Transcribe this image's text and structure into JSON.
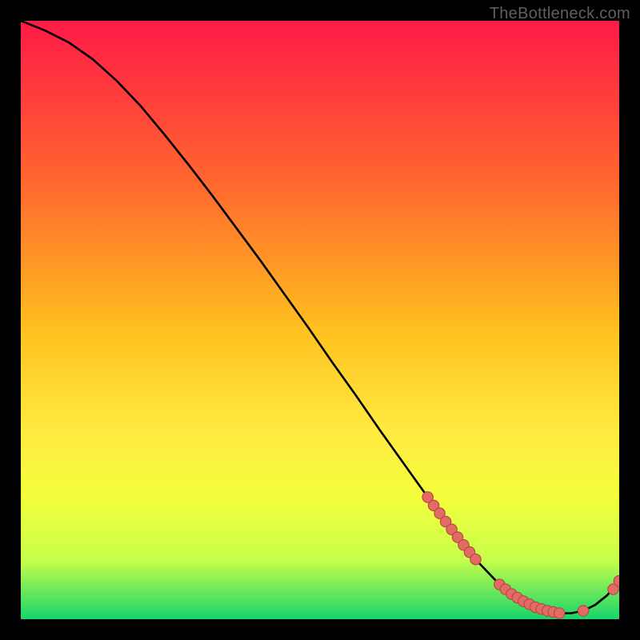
{
  "watermark": "TheBottleneck.com",
  "colors": {
    "gradient_top": "#ff1a47",
    "gradient_mid1": "#ff6a2e",
    "gradient_mid2": "#ffc21f",
    "gradient_mid3": "#ffe940",
    "gradient_mid4": "#f3ff3c",
    "gradient_mid5": "#c7ff4a",
    "gradient_bottom": "#18d46a",
    "curve": "#000000",
    "marker_fill": "#e46a65",
    "marker_stroke": "#b14a42"
  },
  "chart_data": {
    "type": "line",
    "title": "",
    "xlabel": "",
    "ylabel": "",
    "xlim": [
      0,
      100
    ],
    "ylim": [
      0,
      100
    ],
    "curve": {
      "x": [
        0,
        4,
        8,
        12,
        16,
        20,
        24,
        28,
        32,
        36,
        40,
        44,
        48,
        52,
        56,
        60,
        64,
        68,
        72,
        76,
        80,
        82,
        84,
        86,
        88,
        90,
        92,
        94,
        96,
        98,
        100
      ],
      "y": [
        100,
        98.4,
        96.4,
        93.6,
        90.0,
        85.8,
        81.0,
        76.0,
        70.8,
        65.4,
        60.0,
        54.4,
        48.8,
        43.0,
        37.4,
        31.6,
        26.0,
        20.4,
        15.0,
        10.0,
        5.8,
        4.2,
        3.0,
        2.0,
        1.4,
        1.0,
        1.0,
        1.4,
        2.4,
        4.0,
        6.4
      ]
    },
    "markers": {
      "x": [
        68,
        69,
        70,
        71,
        72,
        73,
        74,
        75,
        76,
        80,
        81,
        82,
        83,
        84,
        85,
        86,
        87,
        88,
        89,
        90,
        94,
        99,
        100
      ],
      "y": [
        20.4,
        19.0,
        17.7,
        16.3,
        15.0,
        13.7,
        12.4,
        11.2,
        10.0,
        5.8,
        5.0,
        4.2,
        3.6,
        3.0,
        2.5,
        2.0,
        1.7,
        1.4,
        1.2,
        1.0,
        1.4,
        5.0,
        6.4
      ]
    }
  }
}
